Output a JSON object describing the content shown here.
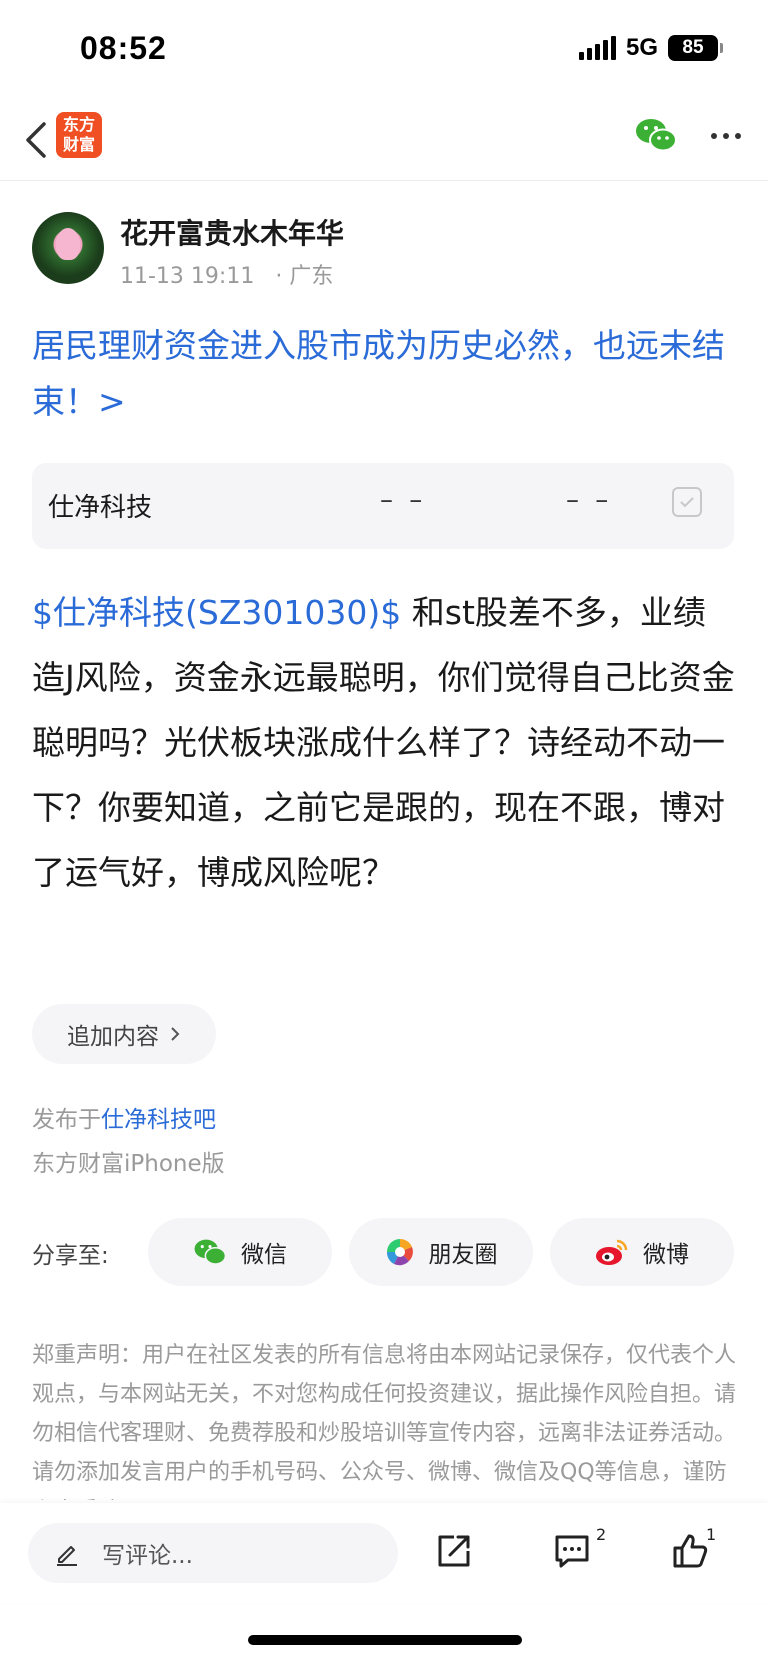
{
  "status_bar": {
    "time": "08:52",
    "network": "5G",
    "battery": "85"
  },
  "nav": {
    "logo_line1": "东方",
    "logo_line2": "财富"
  },
  "post": {
    "author": "花开富贵水木年华",
    "time": "11-13 19:11",
    "separator": "·",
    "location": "广东",
    "title": "居民理财资金进入股市成为历史必然，也远未结束！>",
    "stock_card": {
      "name": "仕净科技",
      "value1": "– –",
      "value2": "– –"
    },
    "stock_tag": "$仕净科技(SZ301030)$",
    "body_text": "  和st股差不多，业绩造J风险，资金永远最聪明，你们觉得自己比资金聪明吗？光伏板块涨成什么样了？诗经动不动一下？你要知道，之前它是跟的，现在不跟，博对了运气好，博成风险呢？",
    "add_content": "追加内容",
    "published_prefix": "发布于",
    "published_bar": "仕净科技吧",
    "client": "东方财富iPhone版"
  },
  "share": {
    "label": "分享至:",
    "wechat": "微信",
    "moments": "朋友圈",
    "weibo": "微博"
  },
  "disclaimer": "郑重声明：用户在社区发表的所有信息将由本网站记录保存，仅代表个人观点，与本网站无关，不对您构成任何投资建议，据此操作风险自担。请勿相信代客理财、免费荐股和炒股培训等宣传内容，远离非法证券活动。请勿添加发言用户的手机号码、公众号、微博、微信及QQ等信息，谨防上当受骗！",
  "bottom_bar": {
    "comment_placeholder": "写评论...",
    "comment_count": "2",
    "like_count": "1"
  },
  "colors": {
    "link_blue": "#2a6bd8",
    "brand_orange": "#f04e23",
    "wechat_green": "#3cb035"
  }
}
